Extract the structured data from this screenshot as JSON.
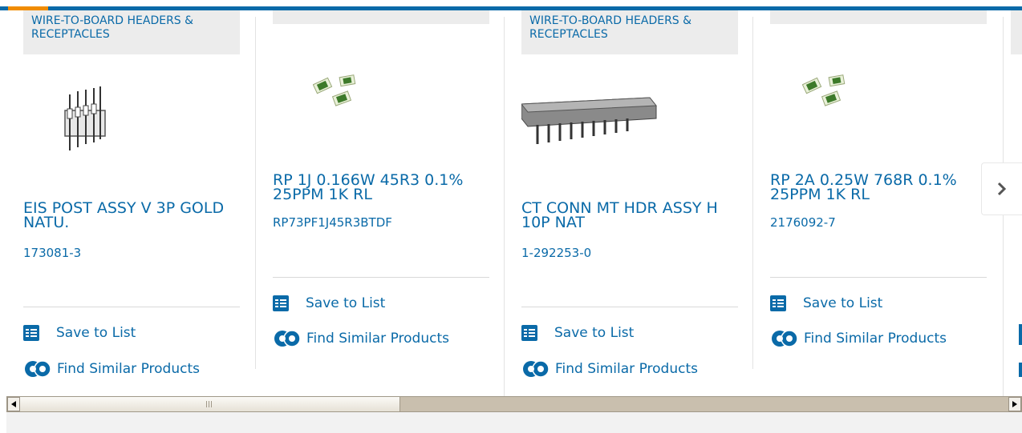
{
  "cards": [
    {
      "category": "WIRE-TO-BOARD HEADERS & RECEPTACLES",
      "title": "EIS POST ASSY V 3P GOLD NATU.",
      "part_number": "173081-3",
      "save_label": "Save to List",
      "similar_label": "Find Similar Products",
      "image": "vertical-post-header"
    },
    {
      "category": "",
      "title": "RP 1J 0.166W 45R3 0.1% 25PPM 1K RL",
      "part_number": "RP73PF1J45R3BTDF",
      "save_label": "Save to List",
      "similar_label": "Find Similar Products",
      "image": "smd-resistors"
    },
    {
      "category": "WIRE-TO-BOARD HEADERS & RECEPTACLES",
      "title": "CT CONN MT HDR ASSY H 10P NAT",
      "part_number": "1-292253-0",
      "save_label": "Save to List",
      "similar_label": "Find Similar Products",
      "image": "horizontal-header"
    },
    {
      "category": "",
      "title": "RP 2A 0.25W 768R 0.1% 25PPM 1K RL",
      "part_number": "2176092-7",
      "save_label": "Save to List",
      "similar_label": "Find Similar Products",
      "image": "smd-resistors"
    }
  ],
  "carousel": {
    "next_icon": "chevron-right-icon"
  },
  "colors": {
    "accent": "#0a6aa8",
    "highlight": "#f08c00"
  }
}
